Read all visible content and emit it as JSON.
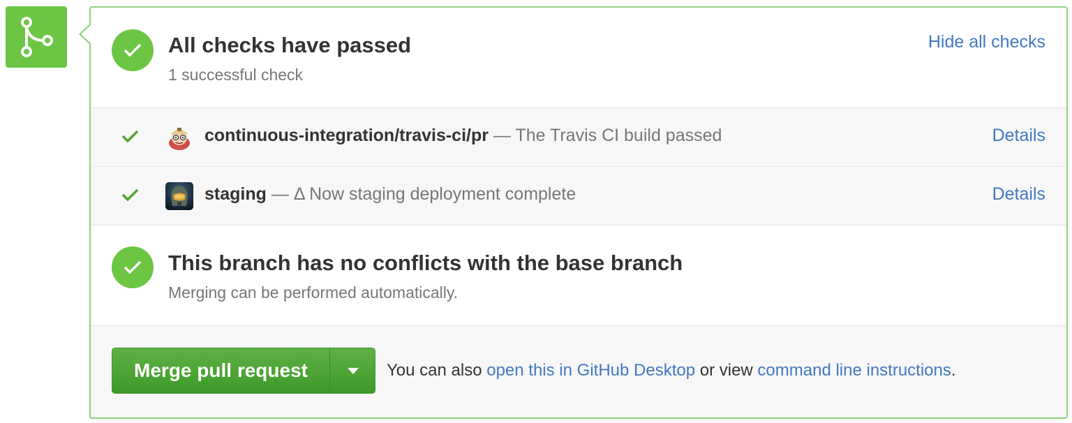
{
  "checks": {
    "title": "All checks have passed",
    "subtitle": "1 successful check",
    "toggle_label": "Hide all checks",
    "items": [
      {
        "context": "continuous-integration/travis-ci/pr",
        "separator": " — ",
        "description": "The Travis CI build passed",
        "link_label": "Details",
        "avatar_icon": "travis-ci-mascot-icon"
      },
      {
        "context": "staging",
        "separator": " — ",
        "description": "Δ Now staging deployment complete",
        "link_label": "Details",
        "avatar_icon": "halo-helmet-icon"
      }
    ]
  },
  "conflicts": {
    "title": "This branch has no conflicts with the base branch",
    "subtitle": "Merging can be performed automatically."
  },
  "merge": {
    "button_label": "Merge pull request",
    "hint_prefix": "You can also ",
    "desktop_link": "open this in GitHub Desktop",
    "hint_middle": " or view ",
    "cli_link": "command line instructions",
    "hint_suffix": "."
  },
  "colors": {
    "success_green": "#6cc644",
    "link_blue": "#4078c0",
    "panel_border": "#8fd17d"
  },
  "icons": {
    "merge": "git-merge-icon",
    "status": "check-icon",
    "dropdown": "triangle-down-icon"
  }
}
